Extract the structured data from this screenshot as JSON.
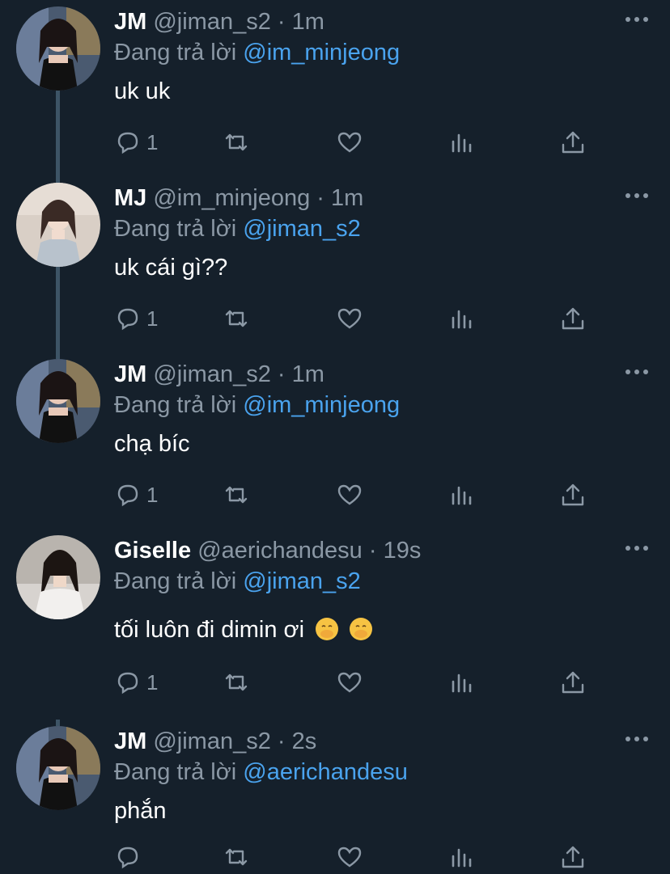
{
  "tweets": [
    {
      "name": "JM",
      "handle": "@jiman_s2",
      "separator": "·",
      "time": "1m",
      "reply_prefix": "Đang trả lời",
      "reply_to": "@im_minjeong",
      "text": "uk uk",
      "reply_count": "1",
      "avatar": "jm-avatar"
    },
    {
      "name": "MJ",
      "handle": "@im_minjeong",
      "separator": "·",
      "time": "1m",
      "reply_prefix": "Đang trả lời",
      "reply_to": "@jiman_s2",
      "text": "uk cái gì??",
      "reply_count": "1",
      "avatar": "mj-avatar"
    },
    {
      "name": "JM",
      "handle": "@jiman_s2",
      "separator": "·",
      "time": "1m",
      "reply_prefix": "Đang trả lời",
      "reply_to": "@im_minjeong",
      "text": "chạ bíc",
      "reply_count": "1",
      "avatar": "jm-avatar"
    },
    {
      "name": "Giselle",
      "handle": "@aerichandesu",
      "separator": "·",
      "time": "19s",
      "reply_prefix": "Đang trả lời",
      "reply_to": "@jiman_s2",
      "text": "tối luôn đi dimin ơi",
      "reply_count": "1",
      "emojis": [
        "🤭",
        "🤭"
      ],
      "avatar": "giselle-avatar"
    },
    {
      "name": "JM",
      "handle": "@jiman_s2",
      "separator": "·",
      "time": "2s",
      "reply_prefix": "Đang trả lời",
      "reply_to": "@aerichandesu",
      "text": "phắn",
      "reply_count": "",
      "avatar": "jm-avatar"
    }
  ],
  "icons": {
    "reply": "reply-icon",
    "retweet": "retweet-icon",
    "like": "heart-icon",
    "stats": "stats-icon",
    "share": "share-icon",
    "more": "more-icon"
  },
  "colors": {
    "background": "#15202b",
    "mention": "#4aa3ee",
    "secondary_text": "#8b98a5",
    "thread_line": "#3d5466"
  }
}
